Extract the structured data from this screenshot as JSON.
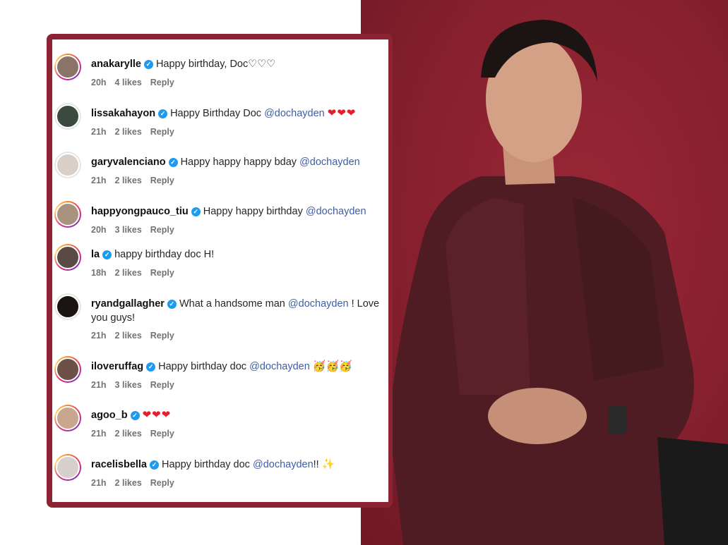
{
  "comments": [
    {
      "username": "anakarylle",
      "text": "Happy birthday, Doc♡♡♡",
      "mention": "",
      "after": "",
      "emoji": "",
      "time": "20h",
      "likes": "4 likes",
      "reply": "Reply"
    },
    {
      "username": "lissakahayon",
      "text": "Happy Birthday Doc",
      "mention": "@dochayden",
      "after": "",
      "emoji": "❤❤❤",
      "time": "21h",
      "likes": "2 likes",
      "reply": "Reply"
    },
    {
      "username": "garyvalenciano",
      "text": "Happy happy happy bday",
      "mention": "@dochayden",
      "after": "",
      "emoji": "",
      "time": "21h",
      "likes": "2 likes",
      "reply": "Reply"
    },
    {
      "username": "happyongpauco_tiu",
      "text": "Happy happy birthday",
      "mention": "@dochayden",
      "after": "",
      "emoji": "",
      "time": "20h",
      "likes": "3 likes",
      "reply": "Reply"
    },
    {
      "username": "la",
      "text": "happy birthday doc H!",
      "mention": "",
      "after": "",
      "emoji": "",
      "time": "18h",
      "likes": "2 likes",
      "reply": "Reply"
    },
    {
      "username": "ryandgallagher",
      "text": "What a handsome man",
      "mention": "@dochayden",
      "after": "! Love you guys!",
      "emoji": "",
      "time": "21h",
      "likes": "2 likes",
      "reply": "Reply"
    },
    {
      "username": "iloveruffag",
      "text": "Happy birthday doc",
      "mention": "@dochayden",
      "after": "",
      "emoji": "🥳🥳🥳",
      "time": "21h",
      "likes": "3 likes",
      "reply": "Reply"
    },
    {
      "username": "agoo_b",
      "text": "",
      "mention": "",
      "after": "",
      "emoji": "❤❤❤",
      "time": "21h",
      "likes": "2 likes",
      "reply": "Reply"
    },
    {
      "username": "racelisbella",
      "text": "Happy birthday doc",
      "mention": "@dochayden",
      "after": "!!",
      "emoji": "✨",
      "time": "21h",
      "likes": "2 likes",
      "reply": "Reply"
    }
  ],
  "colors": {
    "panel_border": "#8c2332",
    "background_red": "#86202e",
    "mention": "#3e5ea8",
    "verified": "#1d9bf0",
    "heart": "#e41f2d"
  },
  "icons": {
    "verified": "verified-badge-icon"
  }
}
